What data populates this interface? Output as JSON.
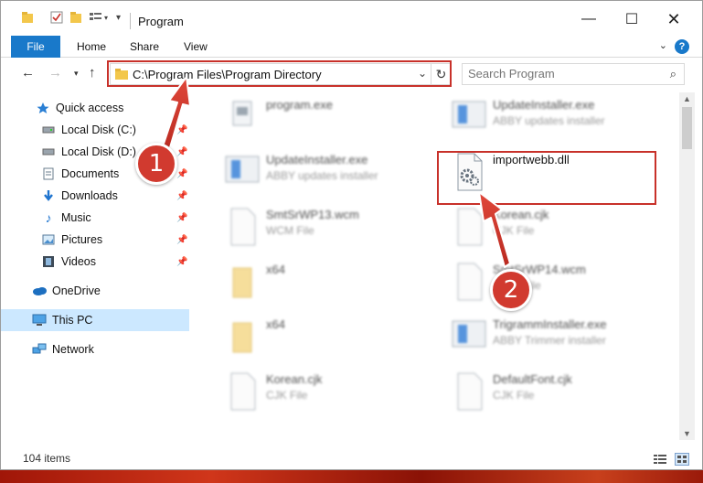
{
  "window": {
    "title": "Program"
  },
  "ribbon": {
    "tabs": [
      "File",
      "Home",
      "Share",
      "View"
    ],
    "help_label": "?"
  },
  "address_bar": {
    "path": "C:\\Program Files\\Program Directory"
  },
  "search": {
    "placeholder": "Search Program"
  },
  "nav_pane": {
    "items": [
      {
        "label": "Quick access",
        "icon": "star-icon",
        "pinned": false
      },
      {
        "label": "Local Disk (C:)",
        "icon": "drive-icon",
        "pinned": true
      },
      {
        "label": "Local Disk (D:)",
        "icon": "drive-icon",
        "pinned": true
      },
      {
        "label": "Documents",
        "icon": "documents-icon",
        "pinned": true
      },
      {
        "label": "Downloads",
        "icon": "download-arrow-icon",
        "pinned": true
      },
      {
        "label": "Music",
        "icon": "music-note-icon",
        "pinned": true
      },
      {
        "label": "Pictures",
        "icon": "pictures-icon",
        "pinned": true
      },
      {
        "label": "Videos",
        "icon": "film-icon",
        "pinned": true
      },
      {
        "label": "OneDrive",
        "icon": "cloud-icon",
        "pinned": false
      },
      {
        "label": "This PC",
        "icon": "computer-icon",
        "pinned": false,
        "selected": true
      },
      {
        "label": "Network",
        "icon": "network-icon",
        "pinned": false
      }
    ]
  },
  "files": [
    {
      "name": "program.exe",
      "type": "",
      "icon": "exe-icon"
    },
    {
      "name": "UpdateInstaller.exe",
      "type": "ABBY updates installer",
      "icon": "installer-icon"
    },
    {
      "name": "UpdateInstaller.exe",
      "type": "ABBY updates installer",
      "icon": "installer-icon"
    },
    {
      "name": "importwebb.dll",
      "type": "",
      "icon": "dll-gear-icon",
      "highlighted": true
    },
    {
      "name": "SmtSrWP13.wcm",
      "type": "WCM File",
      "icon": "blank-file-icon"
    },
    {
      "name": "Korean.cjk",
      "type": "CJK File",
      "icon": "blank-file-icon"
    },
    {
      "name": "x64",
      "type": "",
      "icon": "folder-icon"
    },
    {
      "name": "SmtSrWP14.wcm",
      "type": "WCM File",
      "icon": "blank-file-icon"
    },
    {
      "name": "x64",
      "type": "",
      "icon": "folder-icon"
    },
    {
      "name": "TrigrammInstaller.exe",
      "type": "ABBY Trimmer installer",
      "icon": "installer-icon"
    },
    {
      "name": "Korean.cjk",
      "type": "CJK File",
      "icon": "blank-file-icon"
    },
    {
      "name": "DefaultFont.cjk",
      "type": "CJK File",
      "icon": "blank-file-icon"
    }
  ],
  "status_bar": {
    "item_count": "104 items"
  },
  "annotations": {
    "step1": "1",
    "step2": "2"
  },
  "colors": {
    "accent": "#1979ca",
    "highlight": "#c8312a",
    "badge": "#d13a2f",
    "selected_nav": "#cce8ff"
  }
}
